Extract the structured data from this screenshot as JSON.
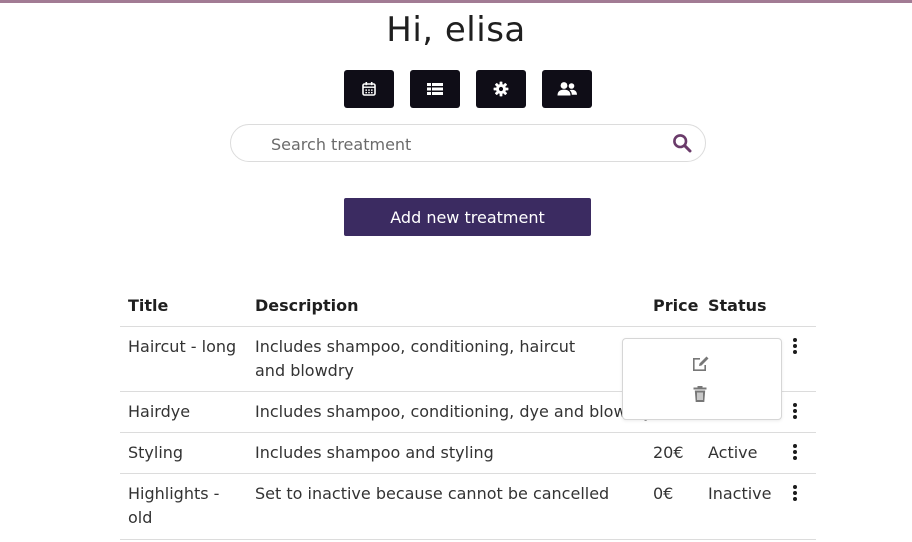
{
  "header": {
    "greeting": "Hi, elisa"
  },
  "nav": {
    "buttons": [
      {
        "icon": "calendar-icon"
      },
      {
        "icon": "list-icon"
      },
      {
        "icon": "gear-icon"
      },
      {
        "icon": "users-icon"
      }
    ]
  },
  "search": {
    "placeholder": "Search treatment",
    "value": ""
  },
  "actions": {
    "add_label": "Add new treatment"
  },
  "table": {
    "headers": {
      "title": "Title",
      "description": "Description",
      "price": "Price",
      "status": "Status"
    },
    "rows": [
      {
        "title": "Haircut - long",
        "description": "Includes shampoo, conditioning, haircut and blowdry",
        "price": "",
        "status": ""
      },
      {
        "title": "Hairdye",
        "description": "Includes shampoo, conditioning, dye and blowdry",
        "price": "",
        "status": ""
      },
      {
        "title": "Styling",
        "description": "Includes shampoo and styling",
        "price": "20€",
        "status": "Active"
      },
      {
        "title": "Highlights - old",
        "description": "Set to inactive because cannot be cancelled",
        "price": "0€",
        "status": "Inactive"
      }
    ]
  },
  "row_menu": {
    "items": [
      {
        "icon": "edit-icon"
      },
      {
        "icon": "trash-icon"
      }
    ]
  },
  "colors": {
    "accent": "#3b2b61",
    "top_border": "#a27b94",
    "icon_button_bg": "#0f0d17",
    "search_icon": "#6a3b6a"
  }
}
